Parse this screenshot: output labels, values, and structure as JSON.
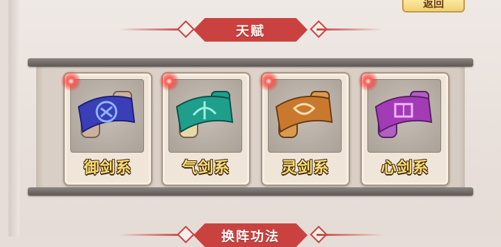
{
  "header": {
    "back_button_label": "返回"
  },
  "section_title": "天赋",
  "cards": [
    {
      "label": "御剑系",
      "color": "#3a3fb8",
      "accent": "#8fb6ff",
      "icon": "sword-scroll-icon"
    },
    {
      "label": "气剑系",
      "color": "#1f9e8c",
      "accent": "#9ff2e0",
      "icon": "sword-scroll-icon"
    },
    {
      "label": "灵剑系",
      "color": "#c9792e",
      "accent": "#ffe0b0",
      "icon": "sword-scroll-icon"
    },
    {
      "label": "心剑系",
      "color": "#a33bb6",
      "accent": "#f2b6ff",
      "icon": "sword-scroll-icon"
    }
  ],
  "next_section_title": "换阵功法"
}
